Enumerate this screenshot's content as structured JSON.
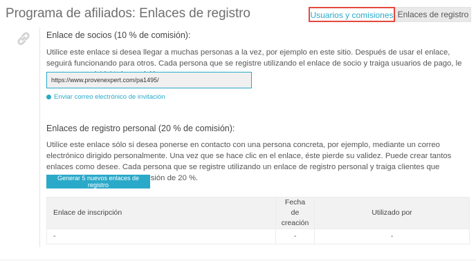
{
  "header": {
    "title": "Programa de afiliados: Enlaces de registro",
    "tabs": [
      {
        "label": "Usuarios y comisiones",
        "active": true
      },
      {
        "label": "Enlaces de registro",
        "active": false
      }
    ]
  },
  "partner_section": {
    "heading": "Enlace de socios (10 % de comisión):",
    "description": "Utilice este enlace si desea llegar a muchas personas a la vez, por ejemplo en este sitio. Después de usar el enlace, seguirá funcionando para otros. Cada persona que se registre utilizando el enlace de socio y traiga usuarios de pago, le aporta a usted 10 % de comisión.",
    "link_value": "https://www.provenexpert.com/pa1495/",
    "invite_label": "Enviar correo electrónico de invitación"
  },
  "personal_section": {
    "heading": "Enlaces de registro personal (20 % de comisión):",
    "description": "Utilice este enlace sólo si desea ponerse en contacto con una persona concreta, por ejemplo, mediante un correo electrónico dirigido personalmente. Una vez que se hace clic en el enlace, éste pierde su validez. Puede crear tantos enlaces como desee. Cada persona que se registre utilizando un enlace de registro personal y traiga clientes que paguen, le reportará una comisión de 20 %.",
    "generate_label": "Generar 5 nuevos enlaces de registro",
    "table": {
      "headers": {
        "link": "Enlace de inscripción",
        "created_line1": "Fecha",
        "created_line2": "de",
        "created_line3": "creación",
        "used_by": "Utilizado por"
      },
      "rows": [
        {
          "link": "-",
          "created": "-",
          "used_by": "-"
        }
      ]
    }
  },
  "colors": {
    "accent": "#2aa9c9",
    "highlight_border": "#e5483c"
  },
  "icons": {
    "section_icon": "link-icon",
    "invite_icon": "dot-icon"
  }
}
